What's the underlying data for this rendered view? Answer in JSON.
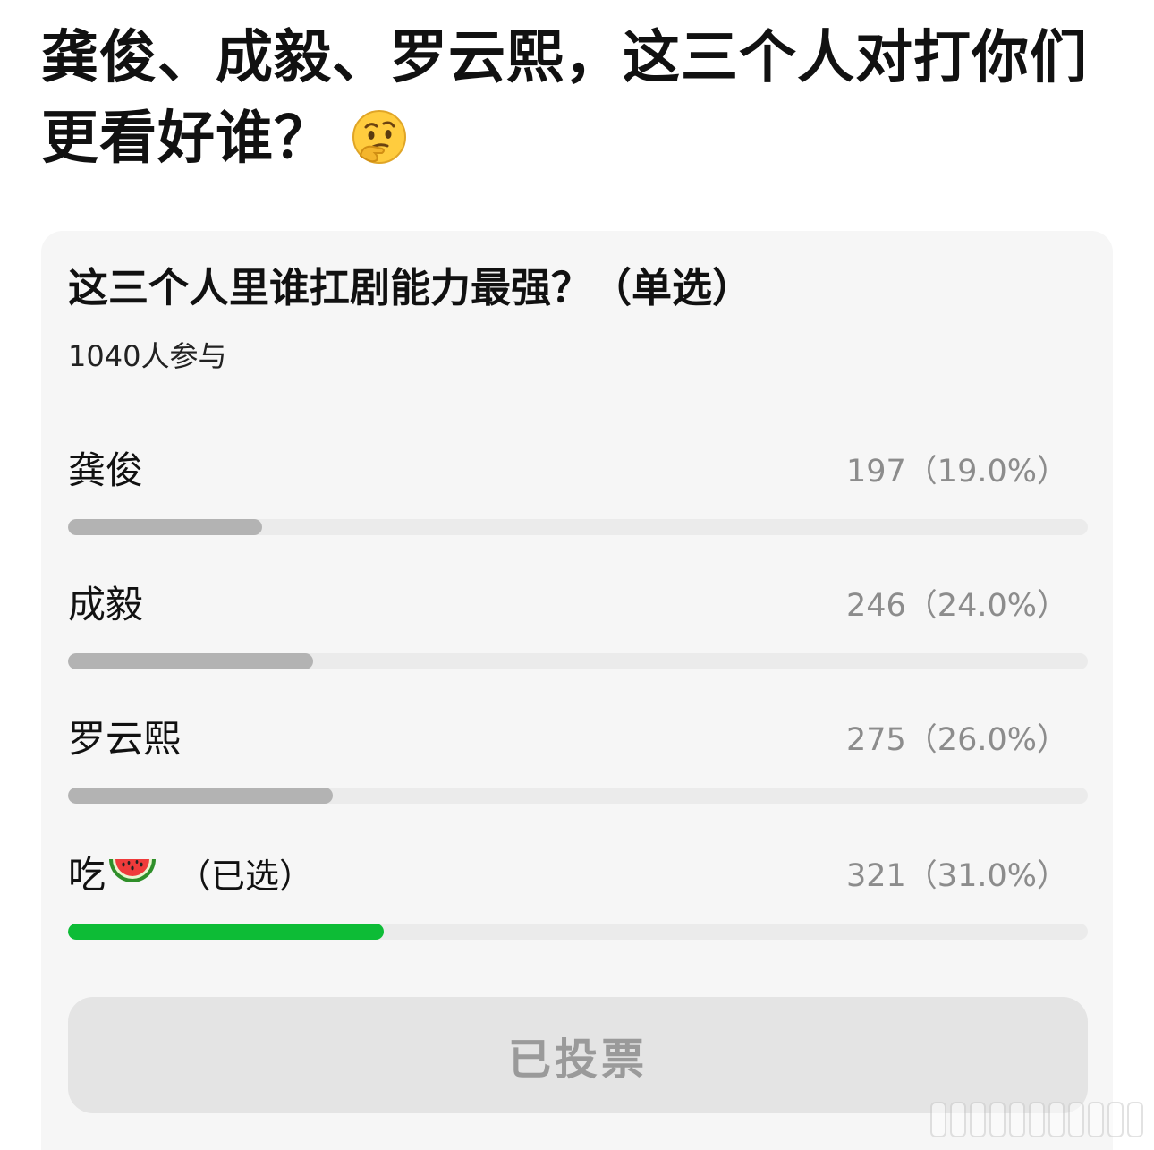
{
  "post": {
    "title": "龚俊、成毅、罗云熙，这三个人对打你们更看好谁？",
    "emoji": "thinking-face-icon"
  },
  "poll": {
    "question": "这三个人里谁扛剧能力最强？（单选）",
    "participants": "1040人参与",
    "options": [
      {
        "label": "龚俊",
        "result": "197（19.0%）",
        "percent": 19.0,
        "selected": false
      },
      {
        "label": "成毅",
        "result": "246（24.0%）",
        "percent": 24.0,
        "selected": false
      },
      {
        "label": "罗云熙",
        "result": "275（26.0%）",
        "percent": 26.0,
        "selected": false
      },
      {
        "label": "吃",
        "icon": "watermelon-icon",
        "selected_tag": "（已选）",
        "result": "321（31.0%）",
        "percent": 31.0,
        "selected": true
      }
    ],
    "vote_button_label": "已投票"
  },
  "colors": {
    "bar_default": "#b3b3b3",
    "bar_selected": "#0dbc36",
    "track": "#ebebeb",
    "card_background": "#f6f6f6"
  }
}
